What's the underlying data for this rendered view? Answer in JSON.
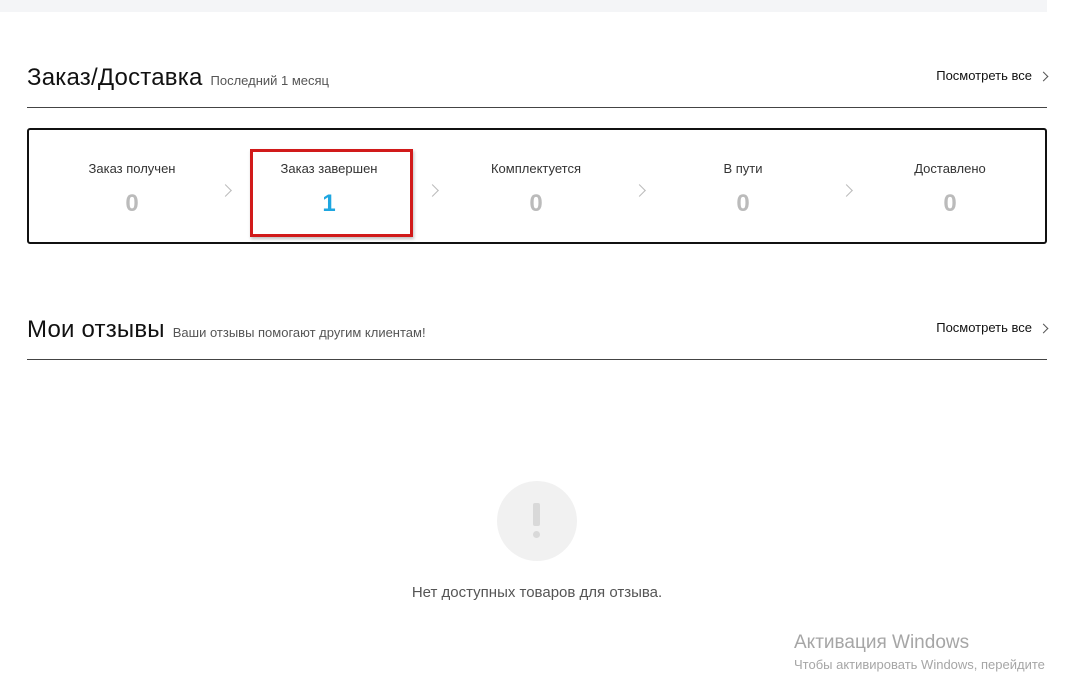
{
  "orders": {
    "title": "Заказ/Доставка",
    "subtitle": "Последний 1 месяц",
    "view_all": "Посмотреть все",
    "steps": [
      {
        "label": "Заказ получен",
        "count": "0"
      },
      {
        "label": "Заказ завершен",
        "count": "1"
      },
      {
        "label": "Комплектуется",
        "count": "0"
      },
      {
        "label": "В пути",
        "count": "0"
      },
      {
        "label": "Доставлено",
        "count": "0"
      }
    ]
  },
  "reviews": {
    "title": "Мои отзывы",
    "subtitle": "Ваши отзывы помогают другим клиентам!",
    "view_all": "Посмотреть все",
    "empty_text": "Нет доступных товаров для отзыва.",
    "empty_icon": "exclamation-icon"
  },
  "windows_watermark": {
    "title": "Активация Windows",
    "subtitle": "Чтобы активировать Windows, перейдите"
  },
  "colors": {
    "active_count": "#1ea6e0",
    "inactive_count": "#bbbbbb",
    "highlight_border": "#d11a1a"
  }
}
